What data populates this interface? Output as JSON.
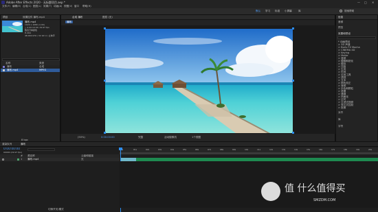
{
  "titlebar": {
    "title": "Adobe After Effects 2020 - 无标题项目.aep *",
    "min": "—",
    "max": "□",
    "close": "✕"
  },
  "menu": [
    "文件(F)",
    "编辑(E)",
    "合成(C)",
    "图层(L)",
    "效果(T)",
    "动画(A)",
    "视图(V)",
    "窗口",
    "帮助(H)"
  ],
  "toolbar": {
    "icons": [
      "home-icon",
      "selection-icon",
      "hand-icon",
      "zoom-icon",
      "rotate-icon",
      "camera-icon",
      "pan-behind-icon",
      "rect-mask-icon",
      "pen-icon",
      "text-icon",
      "brush-icon",
      "clone-icon",
      "eraser-icon",
      "roto-icon",
      "puppet-icon"
    ],
    "glyphs": [
      "⌂",
      "▲",
      "✋",
      "⚲",
      "↻",
      "▣",
      "✥",
      "▭",
      "✒",
      "T",
      "✎",
      "⎘",
      "◇",
      "✱",
      "✦"
    ],
    "workspace": [
      "默认",
      "学习",
      "标准",
      "小屏幕",
      "库"
    ],
    "search": "搜索帮助"
  },
  "project": {
    "tab": "项目",
    "asset_name": "瀑布.mp4",
    "asset_meta": [
      "1920 x 1080 (1.00)",
      "△ 0:00:10:00, 29.97 fps",
      "数百万种颜色",
      "H.264",
      "48.000 kHz / 32 bit U / 立体声"
    ],
    "search_placeholder": "",
    "columns": [
      "名称",
      "类型"
    ],
    "rows": [
      {
        "name": "瀑布",
        "type": "合成"
      },
      {
        "name": "瀑布.mp4",
        "type": "MPEG"
      }
    ],
    "bpc": "8 bpc"
  },
  "effect_controls": {
    "tab": "效果控件 瀑布.mp4"
  },
  "viewer": {
    "tabs": [
      "合成 瀑布",
      "图层 (无)"
    ],
    "breadcrumb": "瀑布",
    "zoom": "(50%)",
    "timecode": "0:00:00:00",
    "quality": "完整",
    "camera": "活动摄像机",
    "views": "1个视图"
  },
  "right_panel": {
    "tab": "信息",
    "sections": [
      "音频",
      "预览",
      "效果和预设"
    ],
    "effects": [
      "* 动画预设",
      "> 3D 声道",
      "> Boris FX Mocha",
      "> CINEMA 4D",
      "> Keying",
      "> Matte",
      "> 音频",
      "> 模糊和锐化",
      "> 模拟",
      "> 扭曲",
      "> 生成",
      "> 时间",
      "> 实用工具",
      "> 透视",
      "> 文本",
      "> 颜色校正",
      "> 音频",
      "> 杂色和颗粒",
      "> 遮罩",
      "> 通道",
      "> 风格化",
      "> 过时",
      "> 沉浸式视频",
      "> 表达式控制",
      "> 抠像"
    ],
    "bottom": [
      "对齐",
      "库",
      "字符"
    ]
  },
  "timeline": {
    "tabs": [
      "渲染队列",
      "瀑布"
    ],
    "timecode": "0:00:00:00",
    "fps": "00000 (29.97 fps)",
    "columns": [
      "#",
      "源名称",
      "父级和链接"
    ],
    "layers": [
      {
        "index": "1",
        "name": "瀑布.mp4",
        "parent": "无"
      }
    ],
    "ruler": [
      "0s",
      "01s",
      "02s",
      "03s",
      "04s",
      "05s",
      "06s",
      "07s",
      "08s",
      "09s",
      "10s",
      "11s",
      "12s",
      "13s",
      "14s",
      "15s",
      "16s",
      "17s",
      "18s",
      "19s",
      "20s"
    ],
    "toggle": "切换开关/模式"
  },
  "watermark": {
    "text": "值 什么值得买",
    "site": "SMZDM.COM"
  },
  "colors": {
    "accent": "#2d8ceb",
    "selection": "#2f5b9a",
    "sea": "#3fc6d0",
    "sky": "#2f7fd4",
    "layer_bar": "#1e8a50"
  }
}
